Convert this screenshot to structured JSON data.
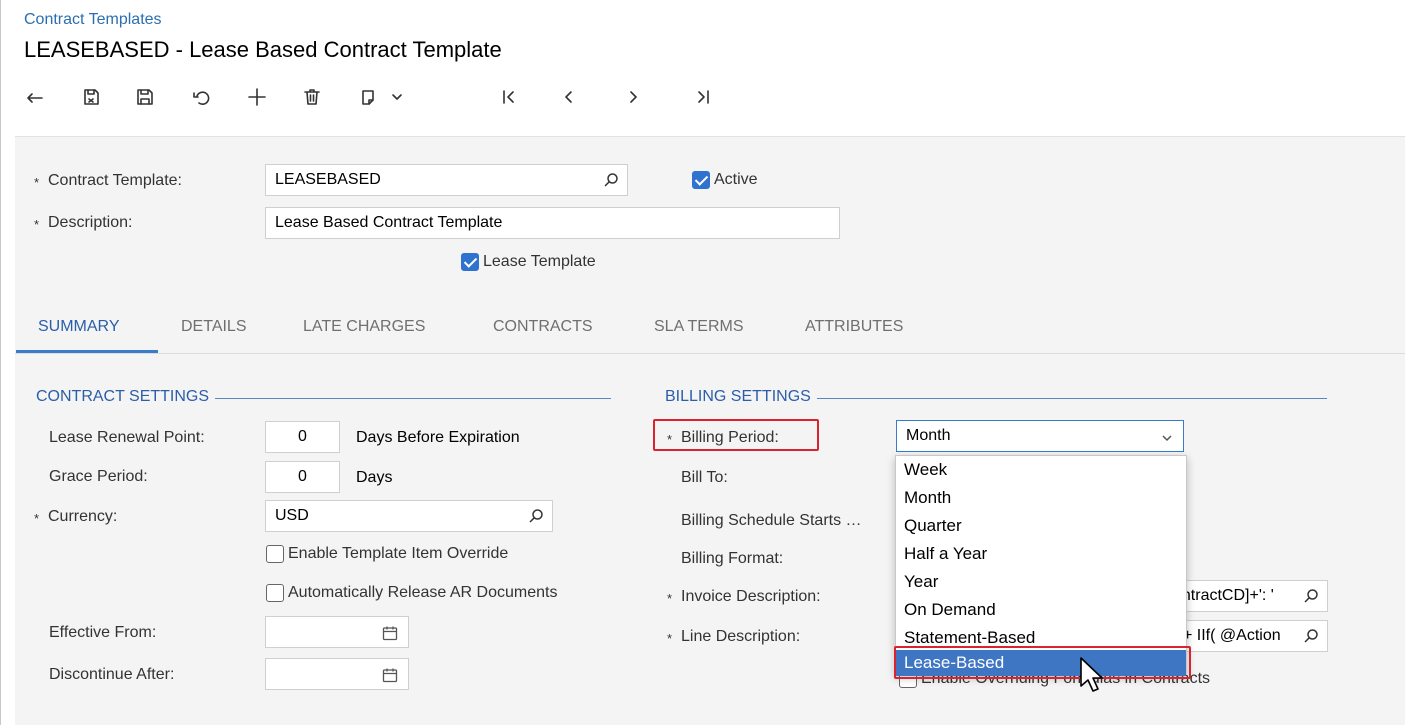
{
  "breadcrumb": "Contract Templates",
  "page_title": "LEASEBASED - Lease Based Contract Template",
  "toolbar": {
    "icons": [
      "back-icon",
      "save-close-icon",
      "save-icon",
      "undo-icon",
      "add-icon",
      "delete-icon",
      "copy-paste-icon",
      "chevron-down-icon",
      "first-record-icon",
      "previous-record-icon",
      "next-record-icon",
      "last-record-icon"
    ]
  },
  "header": {
    "required_mark": "*",
    "contract_template_label": "Contract Template:",
    "contract_template_value": "LEASEBASED",
    "active_label": "Active",
    "description_label": "Description:",
    "description_value": "Lease Based Contract Template",
    "lease_template_label": "Lease Template"
  },
  "tabs": [
    "SUMMARY",
    "DETAILS",
    "LATE CHARGES",
    "CONTRACTS",
    "SLA TERMS",
    "ATTRIBUTES"
  ],
  "contract_settings": {
    "title": "CONTRACT SETTINGS",
    "lease_renewal_label": "Lease Renewal Point:",
    "lease_renewal_value": "0",
    "lease_renewal_unit": "Days Before Expiration",
    "grace_period_label": "Grace Period:",
    "grace_period_value": "0",
    "grace_period_unit": "Days",
    "currency_label": "Currency:",
    "currency_value": "USD",
    "enable_override_label": "Enable Template Item Override",
    "auto_release_label": "Automatically Release AR Documents",
    "effective_from_label": "Effective From:",
    "discontinue_after_label": "Discontinue After:"
  },
  "billing_settings": {
    "title": "BILLING SETTINGS",
    "billing_period_label": "Billing Period:",
    "billing_period_value": "Month",
    "bill_to_label": "Bill To:",
    "schedule_starts_label": "Billing Schedule Starts …",
    "billing_format_label": "Billing Format:",
    "invoice_description_label": "Invoice Description:",
    "invoice_description_value": "ontractCD]+': '",
    "line_description_label": "Line Description:",
    "line_description_value": "+ IIf( @Action",
    "enable_overriding_label": "Enable Overriding Formulas in Contracts",
    "options": [
      "Week",
      "Month",
      "Quarter",
      "Half a Year",
      "Year",
      "On Demand",
      "Statement-Based",
      "Lease-Based"
    ],
    "selected_option": "Lease-Based"
  },
  "colors": {
    "accent": "#3f76c4",
    "highlight_red": "#d9232e",
    "section_blue": "#2b5ea8"
  }
}
